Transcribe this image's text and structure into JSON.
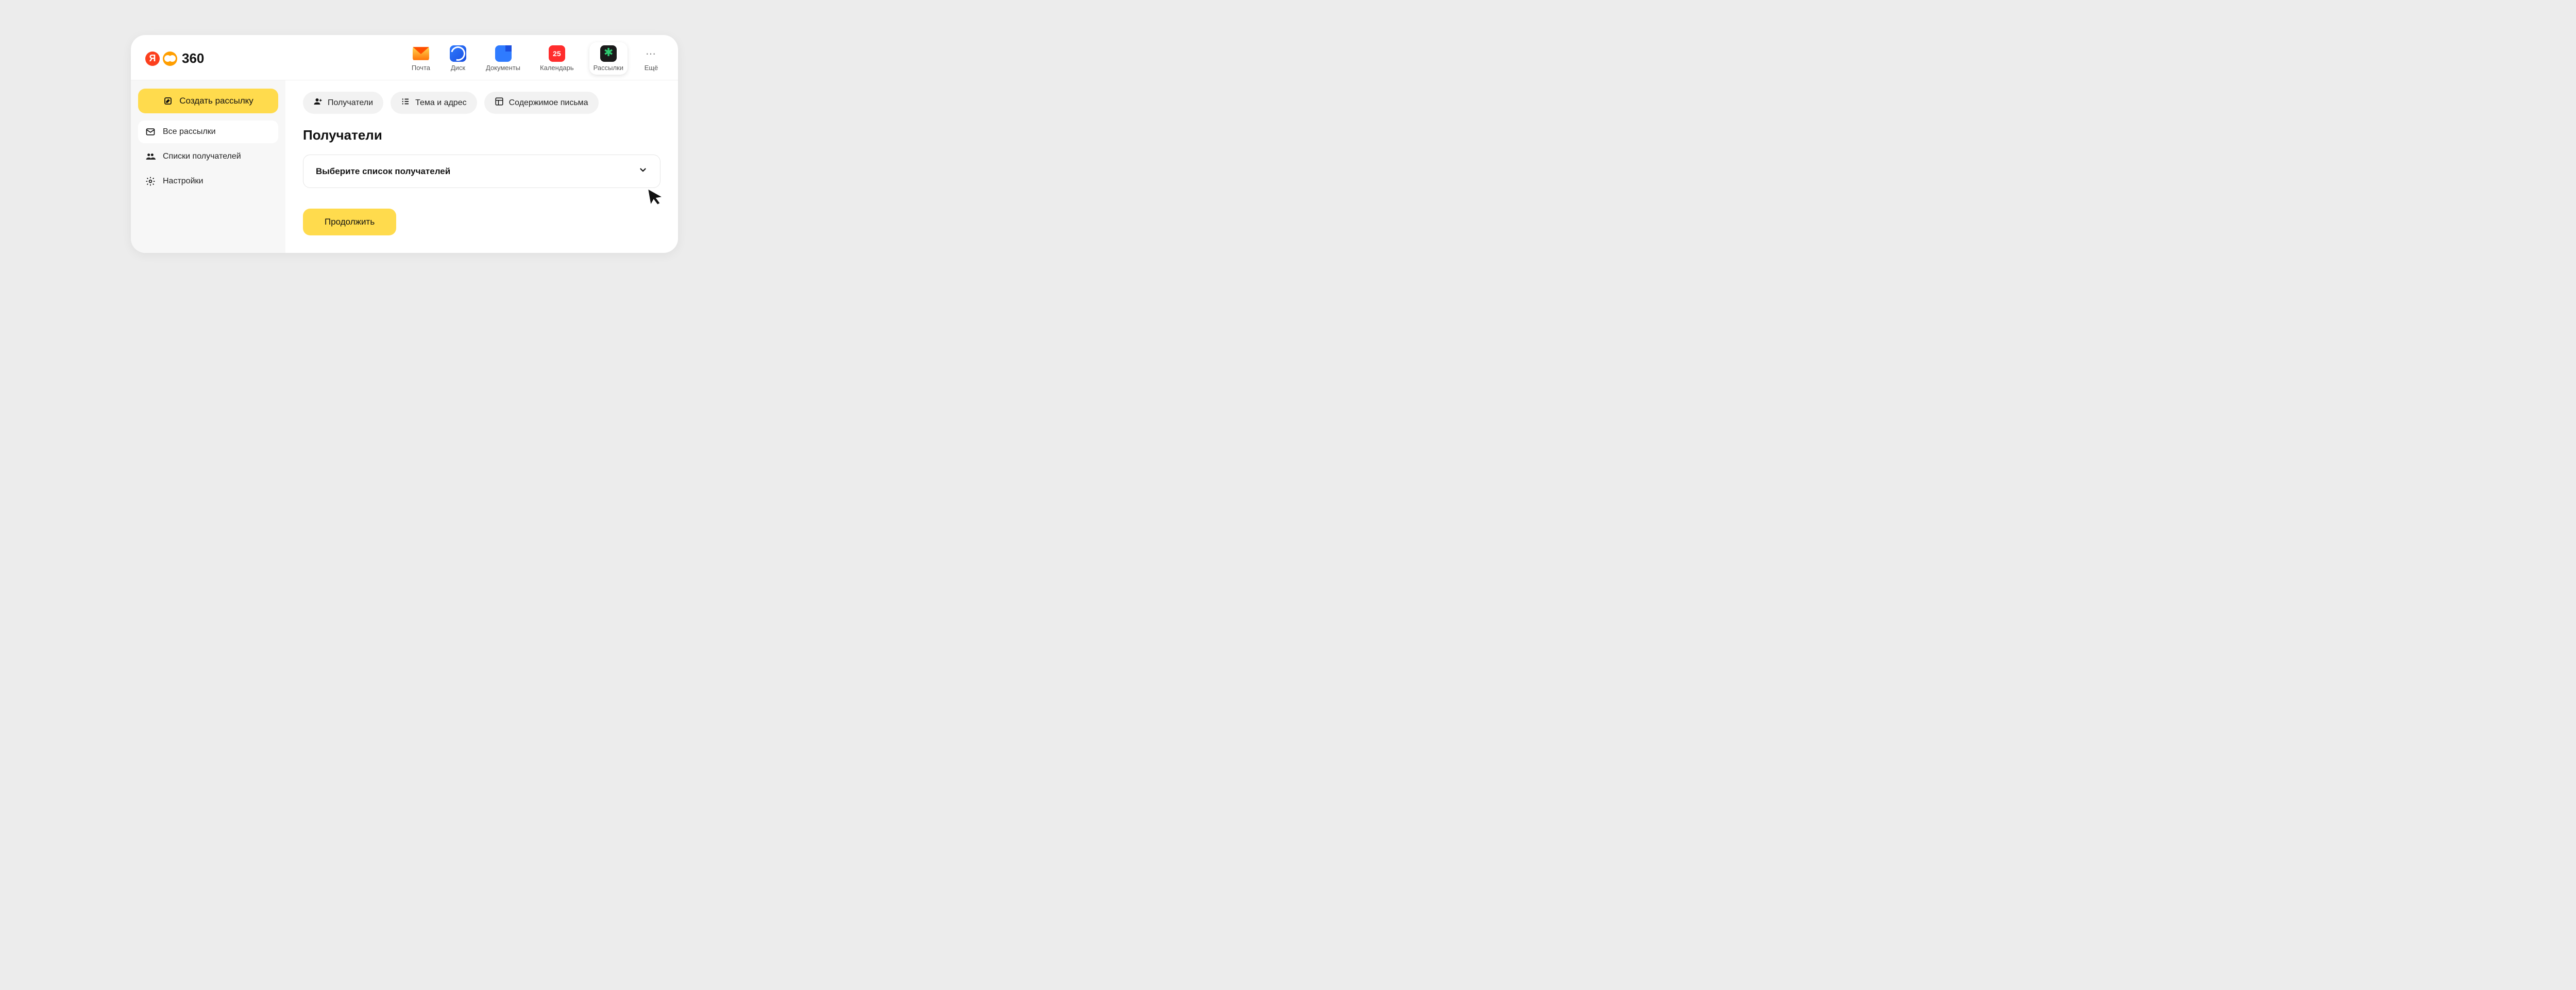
{
  "logo": {
    "text": "360"
  },
  "nav": {
    "items": [
      {
        "label": "Почта",
        "icon": "mail"
      },
      {
        "label": "Диск",
        "icon": "disk"
      },
      {
        "label": "Документы",
        "icon": "docs"
      },
      {
        "label": "Календарь",
        "icon": "cal",
        "badge": "25"
      },
      {
        "label": "Рассылки",
        "icon": "send",
        "active": true
      },
      {
        "label": "Ещё",
        "icon": "more"
      }
    ]
  },
  "sidebar": {
    "create_label": "Создать рассылку",
    "items": [
      {
        "label": "Все рассылки",
        "icon": "envelope",
        "active": true
      },
      {
        "label": "Списки получателей",
        "icon": "people"
      },
      {
        "label": "Настройки",
        "icon": "gear"
      }
    ]
  },
  "steps": [
    {
      "label": "Получатели",
      "icon": "person-add"
    },
    {
      "label": "Тема и адрес",
      "icon": "list"
    },
    {
      "label": "Содержимое письма",
      "icon": "layout"
    }
  ],
  "main": {
    "section_title": "Получатели",
    "select_placeholder": "Выберите список получателей",
    "continue_label": "Продолжить"
  }
}
